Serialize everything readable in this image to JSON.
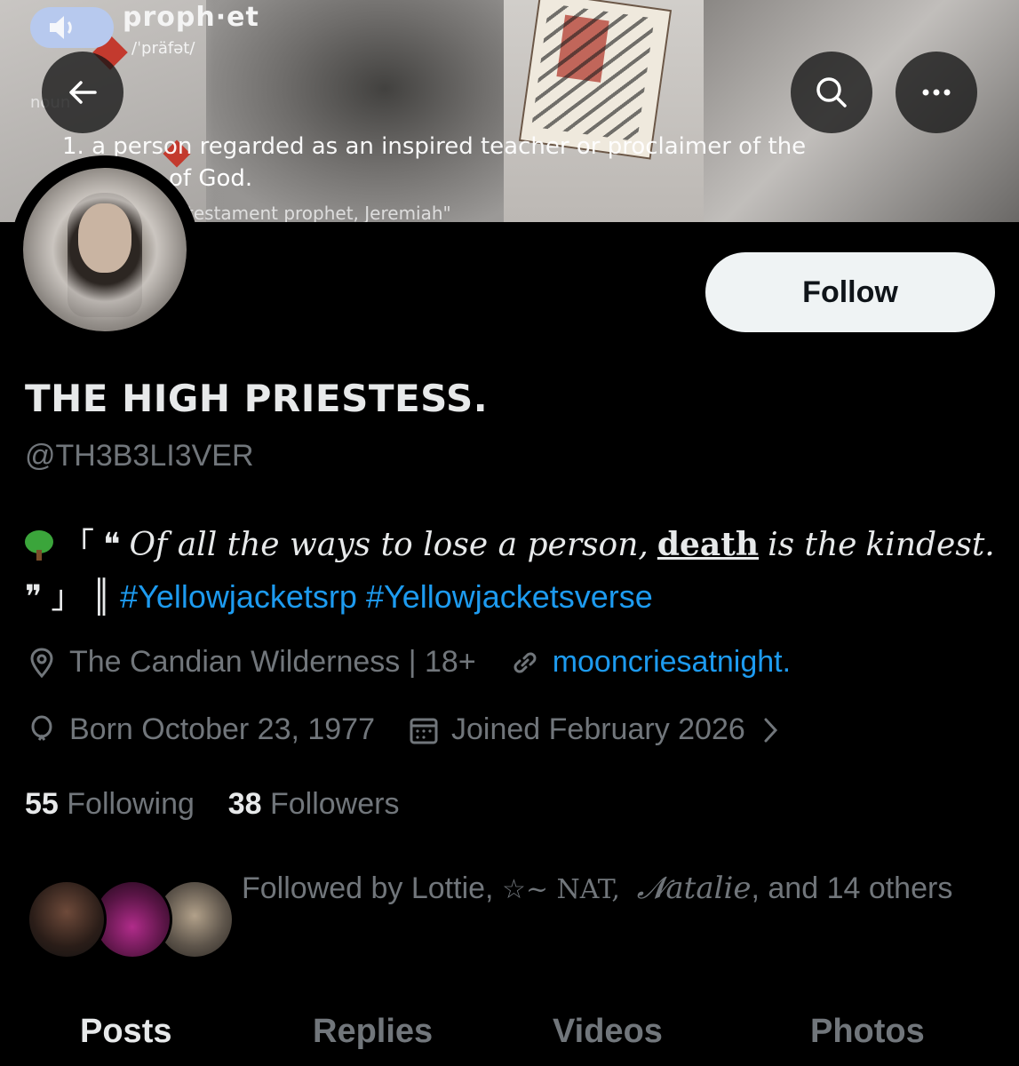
{
  "banner": {
    "word": "proph·et",
    "phonetic": "/ˈpräfət/",
    "pos": "noun",
    "definition_line1": "1. a person regarded as an inspired teacher or proclaimer of the",
    "definition_line2": "of God.",
    "example": "testament prophet, Jeremiah\""
  },
  "header": {
    "back_icon": "arrow-left-icon",
    "search_icon": "search-icon",
    "more_icon": "more-horizontal-icon"
  },
  "profile": {
    "follow_label": "Follow",
    "display_name": "THE HIGH PRIESTESS.",
    "handle": "@TH3B3LI3VER",
    "bio": {
      "open_bracket": "「",
      "open_quote": "❝",
      "quote_part1": "Of all the ways to lose a person,",
      "quote_bold": "death",
      "quote_part2": "is the",
      "quote_part3": "kindest.",
      "close_quote": "❞",
      "close_bracket": "」",
      "divider": "║",
      "hashtag1": "#Yellowjacketsrp",
      "hashtag2": "#Yellowjacketsverse"
    },
    "location": "The Candian Wilderness | 18+",
    "website": "mooncriesatnight.",
    "birthday": "Born October 23, 1977",
    "joined": "Joined February 2026",
    "following_count": "55",
    "following_label": "Following",
    "followers_count": "38",
    "followers_label": "Followers",
    "followed_by": {
      "prefix": "Followed by Lottie,",
      "name2": "☆~ NAT,",
      "name3": "𝓝atalie",
      "suffix": ", and 14 others"
    }
  },
  "tabs": [
    "Posts",
    "Replies",
    "Videos",
    "Photos"
  ],
  "colors": {
    "background": "#000000",
    "text_primary": "#e7e9ea",
    "text_secondary": "#71767b",
    "link": "#1d9bf0",
    "follow_button": "#eff3f4"
  }
}
